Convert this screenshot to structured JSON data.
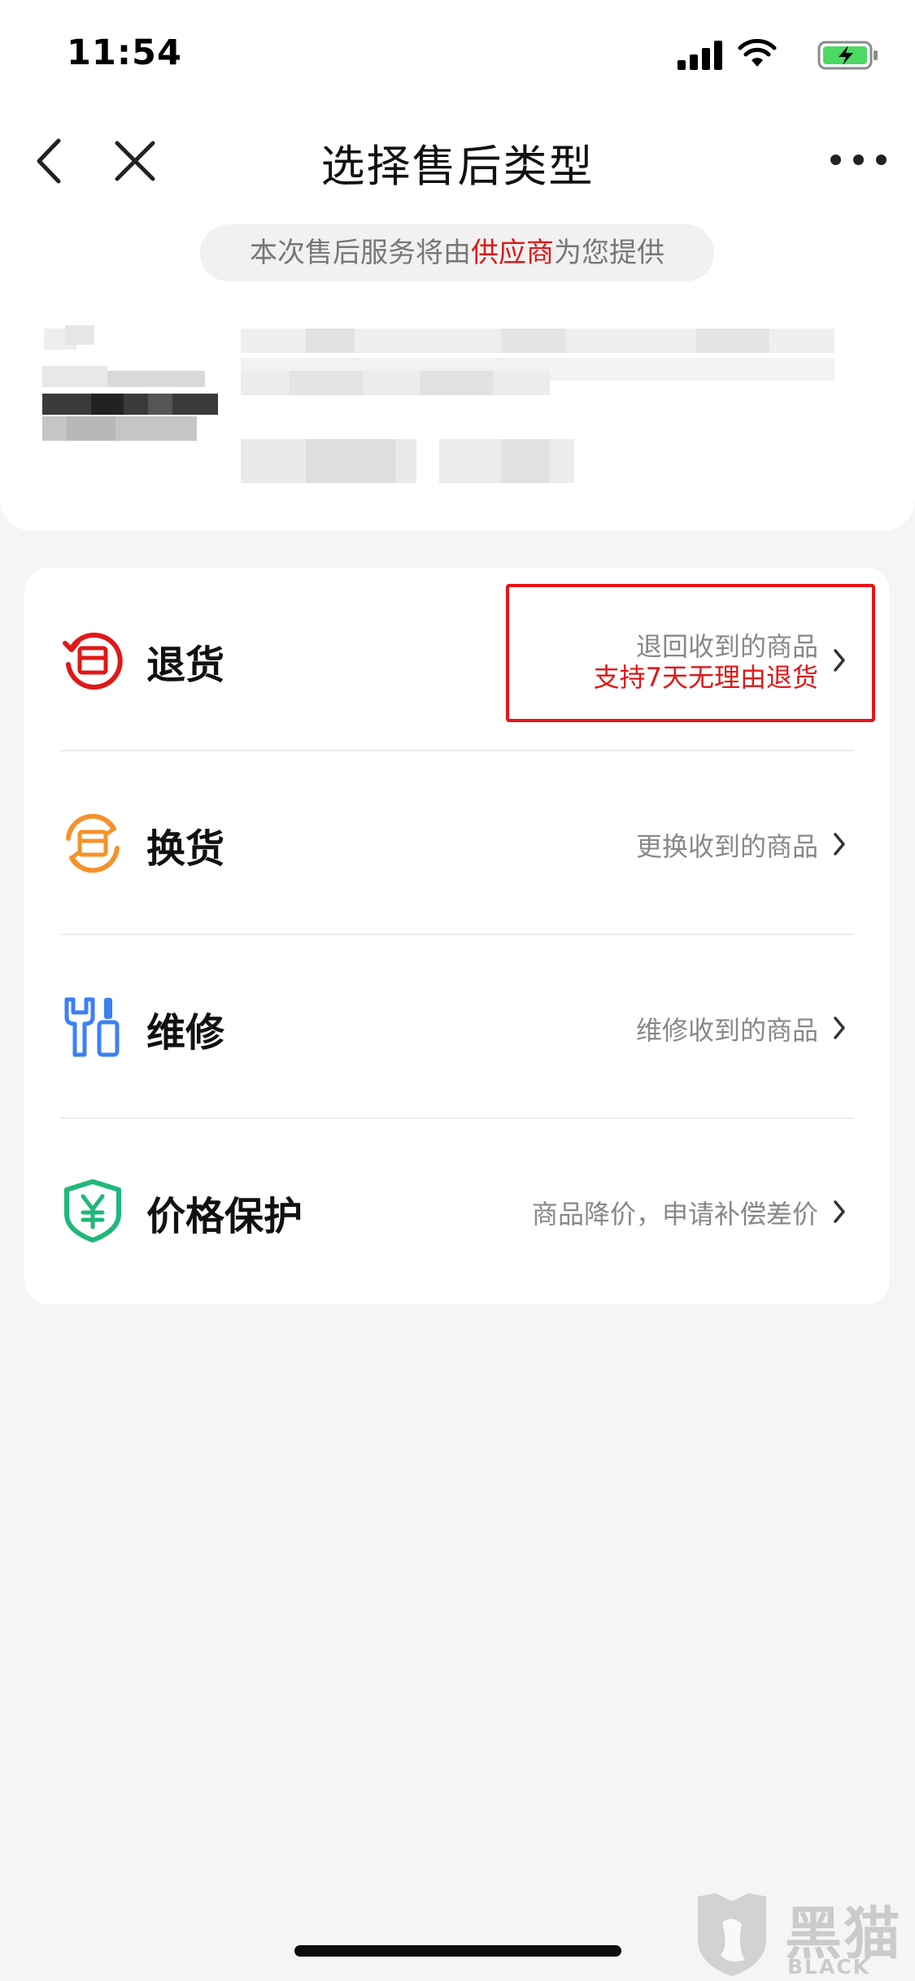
{
  "status_bar": {
    "time": "11:54"
  },
  "nav": {
    "title": "选择售后类型"
  },
  "notice": {
    "prefix": "本次售后服务将由",
    "highlight": "供应商",
    "suffix": "为您提供"
  },
  "options": [
    {
      "label": "退货",
      "desc": "退回收到的商品",
      "desc_highlight": "支持7天无理由退货",
      "icon": "return-goods-icon"
    },
    {
      "label": "换货",
      "desc": "更换收到的商品",
      "icon": "exchange-goods-icon"
    },
    {
      "label": "维修",
      "desc": "维修收到的商品",
      "icon": "repair-tools-icon"
    },
    {
      "label": "价格保护",
      "desc": "商品降价，申请补偿差价",
      "icon": "yuan-shield-icon"
    }
  ],
  "watermark": {
    "cn": "黑猫",
    "en": "BLACK CAT"
  },
  "colors": {
    "accent_red": "#e01818",
    "exchange_orange": "#f5922a",
    "repair_blue": "#3d7ff5",
    "price_green": "#1fb87a"
  }
}
